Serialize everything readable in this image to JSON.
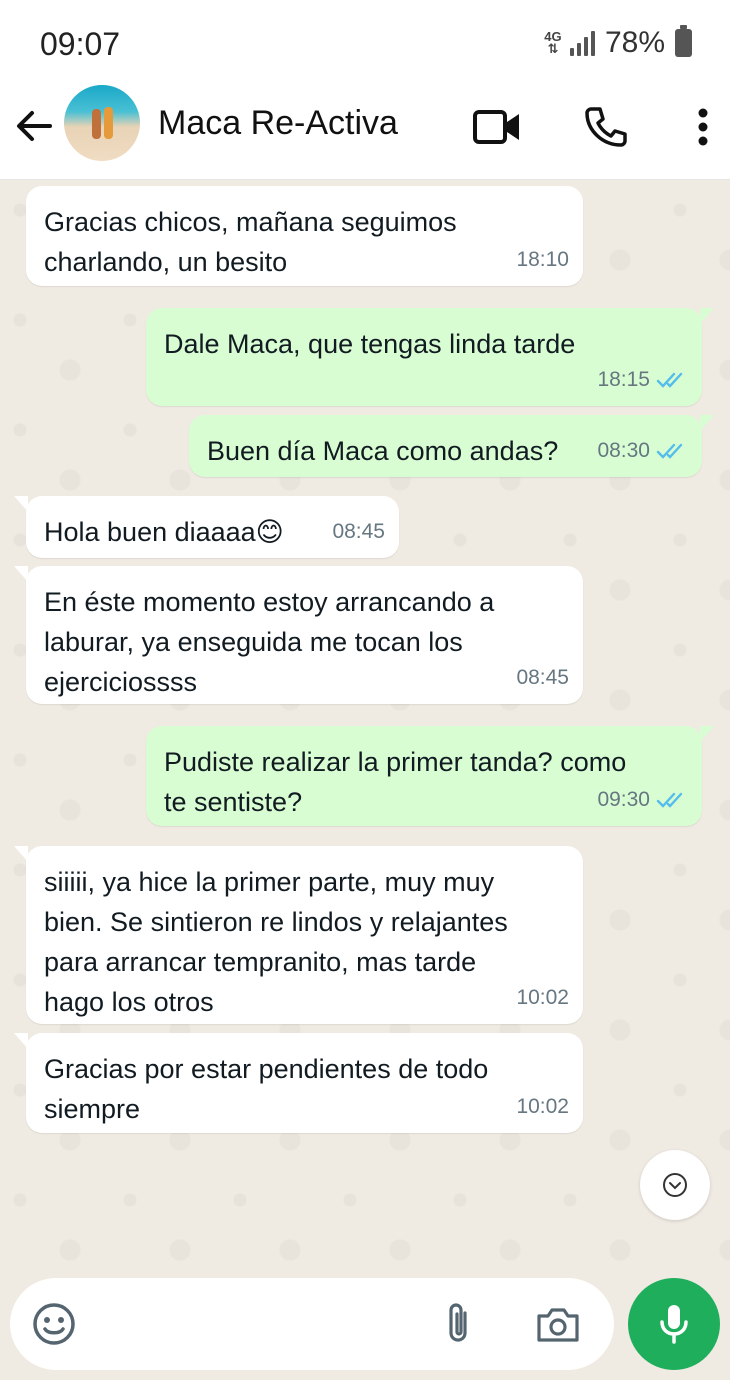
{
  "status_bar": {
    "time": "09:07",
    "network": "4G",
    "battery": "78%"
  },
  "header": {
    "contact_name": "Maca Re-Activa",
    "icons": [
      "back-arrow-icon",
      "video-call-icon",
      "phone-icon",
      "more-vert-icon"
    ]
  },
  "messages": [
    {
      "direction": "in",
      "text": "Gracias chicos, mañana seguimos\ncharlando, un besito",
      "time": "18:10"
    },
    {
      "direction": "out",
      "text": "Dale Maca, que tengas linda tarde",
      "time": "18:15",
      "status": "read"
    },
    {
      "direction": "out",
      "text": "Buen día Maca como andas?",
      "time": "08:30",
      "status": "read"
    },
    {
      "direction": "in",
      "text": "Hola buen diaaaa😊",
      "time": "08:45"
    },
    {
      "direction": "in",
      "text": "En éste momento estoy arrancando a\nlaburar, ya enseguida me tocan los\nejerciciossss",
      "time": "08:45"
    },
    {
      "direction": "out",
      "text": "Pudiste realizar la primer tanda? como\nte sentiste?",
      "time": "09:30",
      "status": "read"
    },
    {
      "direction": "in",
      "text": "siiiii, ya hice la primer parte, muy muy\nbien. Se sintieron re lindos y relajantes\npara arrancar tempranito, mas tarde\nhago los otros",
      "time": "10:02"
    },
    {
      "direction": "in",
      "text": "Gracias por estar pendientes de todo\nsiempre",
      "time": "10:02"
    }
  ],
  "input": {
    "placeholder": "",
    "icons": [
      "emoji-icon",
      "attach-icon",
      "camera-icon",
      "mic-icon"
    ]
  },
  "colors": {
    "incoming_bubble": "#ffffff",
    "outgoing_bubble": "#d9fdd3",
    "read_ticks": "#53bdeb",
    "mic_button": "#1fae5c",
    "chat_background": "#efeae2"
  }
}
